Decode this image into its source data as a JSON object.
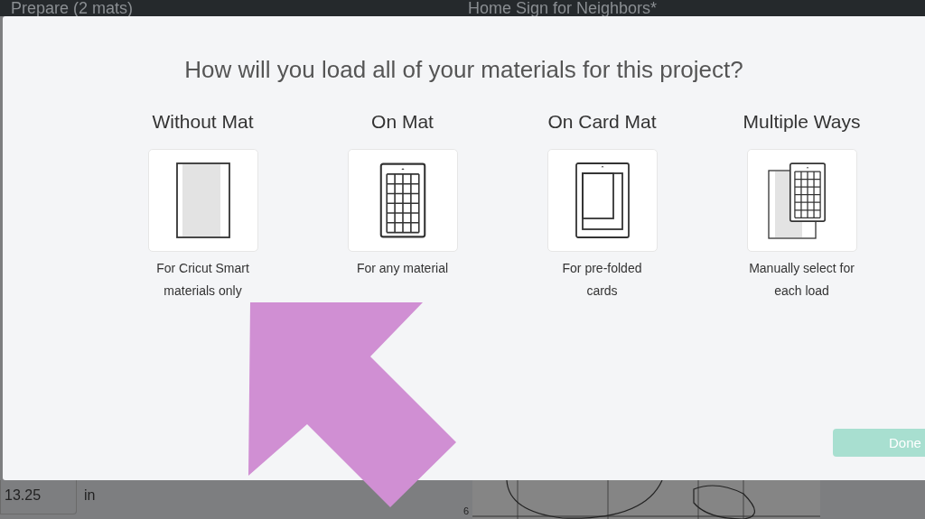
{
  "top_bar": {
    "left_title": "Prepare (2 mats)",
    "center_title": "Home Sign for Neighbors*"
  },
  "dialog": {
    "heading": "How will you load all of your materials for this project?",
    "options": [
      {
        "kind": "without_mat",
        "title": "Without Mat",
        "description": "For Cricut Smart materials only"
      },
      {
        "kind": "on_mat",
        "title": "On Mat",
        "description": "For any material"
      },
      {
        "kind": "card_mat",
        "title": "On Card Mat",
        "description": "For pre-folded cards"
      },
      {
        "kind": "multiple",
        "title": "Multiple Ways",
        "description": "Manually select for each load"
      }
    ],
    "done_button": {
      "label": "Done",
      "disabled": true
    }
  },
  "background": {
    "size_value": "13.25",
    "size_unit": "in",
    "ruler_mark": "6"
  }
}
